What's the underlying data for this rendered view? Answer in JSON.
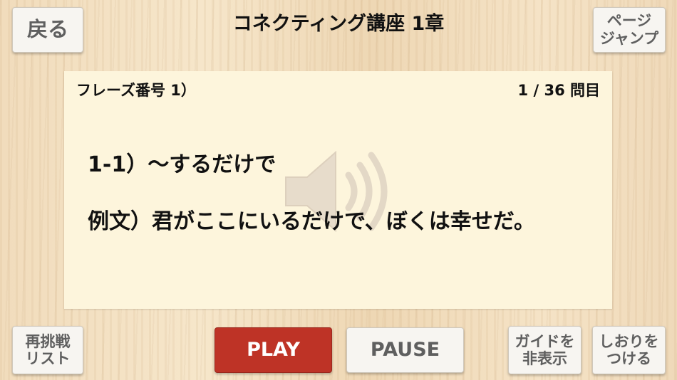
{
  "header": {
    "back_label": "戻る",
    "title": "コネクティング講座 1章",
    "page_jump_label": "ページ\nジャンプ"
  },
  "card": {
    "phrase_number": "フレーズ番号 1）",
    "counter": "1 / 36 問目",
    "phrase": "1-1）～するだけで",
    "example": "例文）君がここにいるだけで、ぼくは幸せだ。"
  },
  "footer": {
    "retry_list_label": "再挑戦\nリスト",
    "play_label": "PLAY",
    "pause_label": "PAUSE",
    "hide_guide_label": "ガイドを\n非表示",
    "bookmark_label": "しおりを\nつける"
  },
  "colors": {
    "play_button": "#be3326",
    "card_background": "#fdf5dc"
  },
  "icons": {
    "watermark": "speaker-icon"
  }
}
